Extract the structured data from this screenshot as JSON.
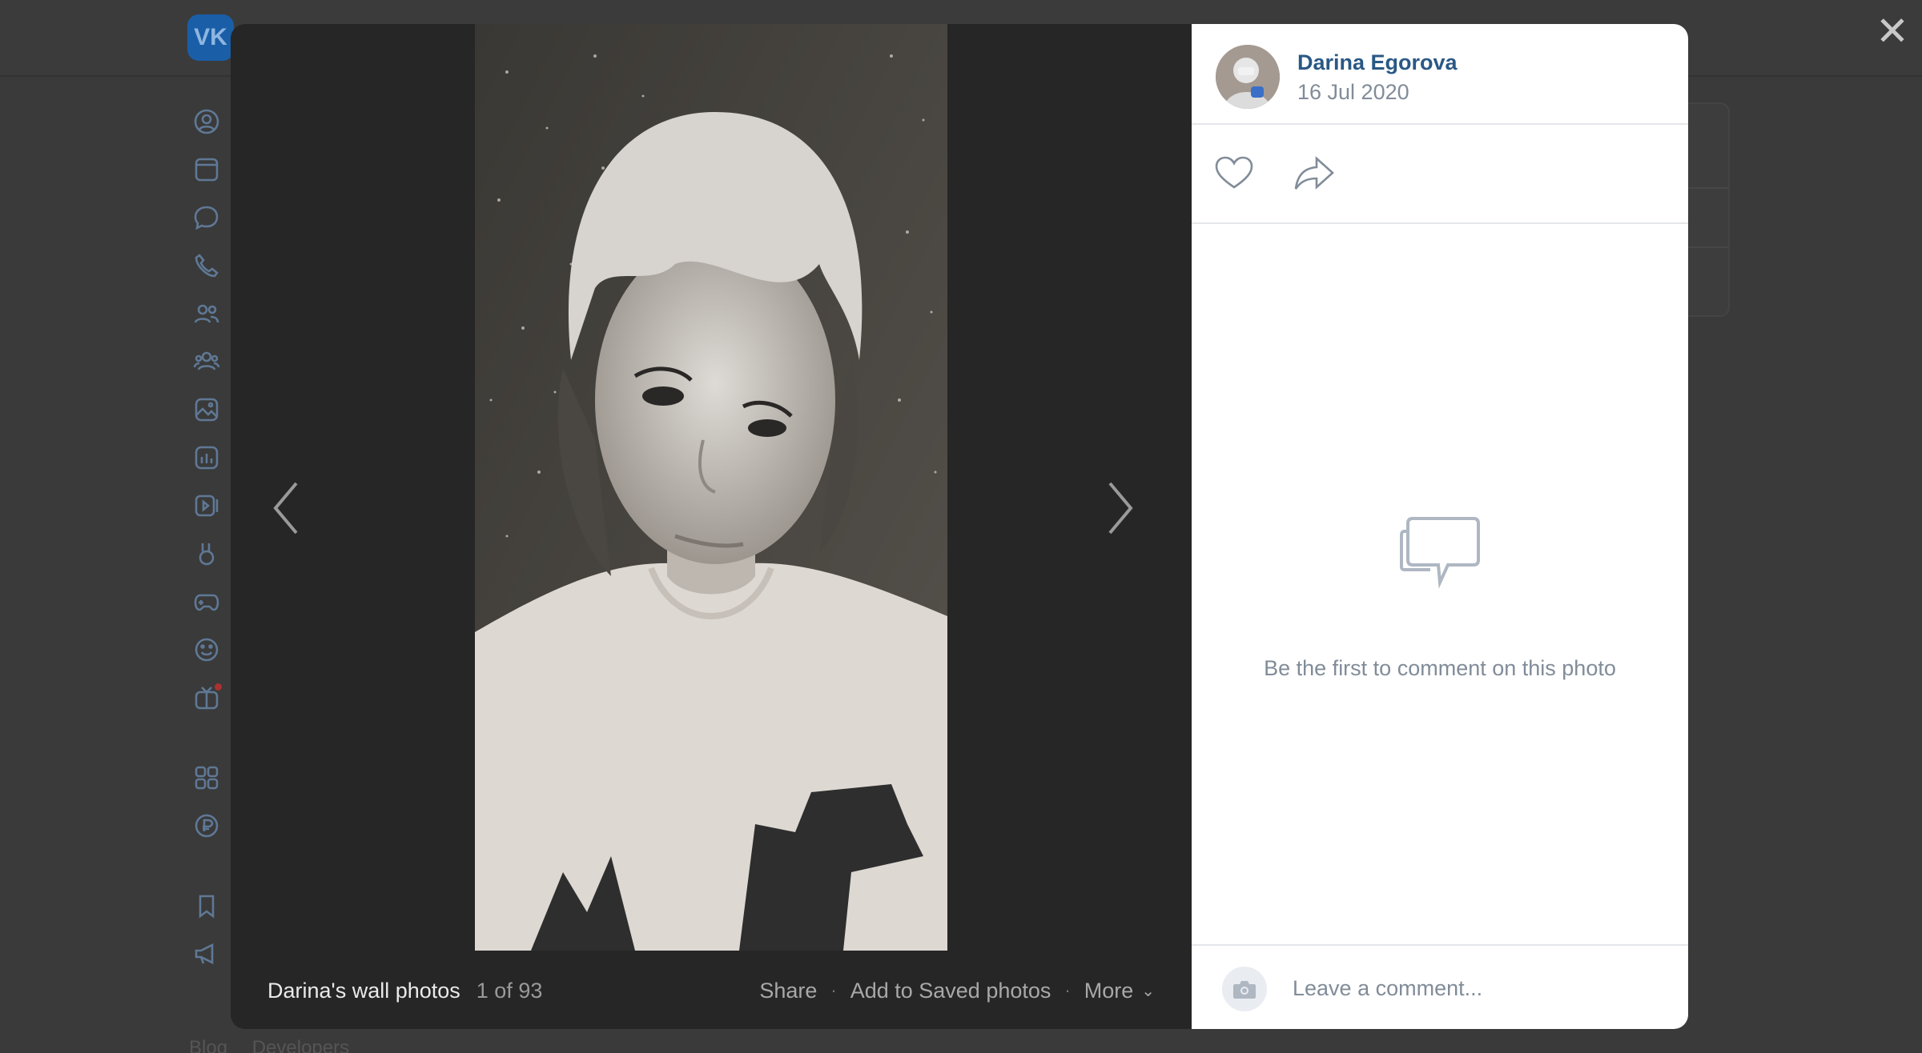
{
  "viewer": {
    "author_name": "Darina Egorova",
    "date": "16 Jul 2020",
    "album_title": "Darina's wall photos",
    "counter": "1 of 93",
    "actions": {
      "share": "Share",
      "save": "Add to Saved photos",
      "more": "More"
    },
    "empty_comments_text": "Be the first to comment on this photo",
    "comment_placeholder": "Leave a comment..."
  },
  "background": {
    "footer_links": [
      "Blog",
      "Developers"
    ]
  },
  "colors": {
    "link": "#2a5885",
    "muted": "#818c99",
    "overlay": "#262626"
  },
  "icons": {
    "sidebar": [
      "profile-icon",
      "news-icon",
      "messenger-icon",
      "calls-icon",
      "friends-icon",
      "communities-icon",
      "photos-icon",
      "music-icon",
      "video-icon",
      "clips-icon",
      "games-icon",
      "stickers-icon",
      "gifts-icon",
      "services-icon",
      "vk-pay-icon",
      "bookmarks-icon",
      "ads-icon"
    ]
  }
}
